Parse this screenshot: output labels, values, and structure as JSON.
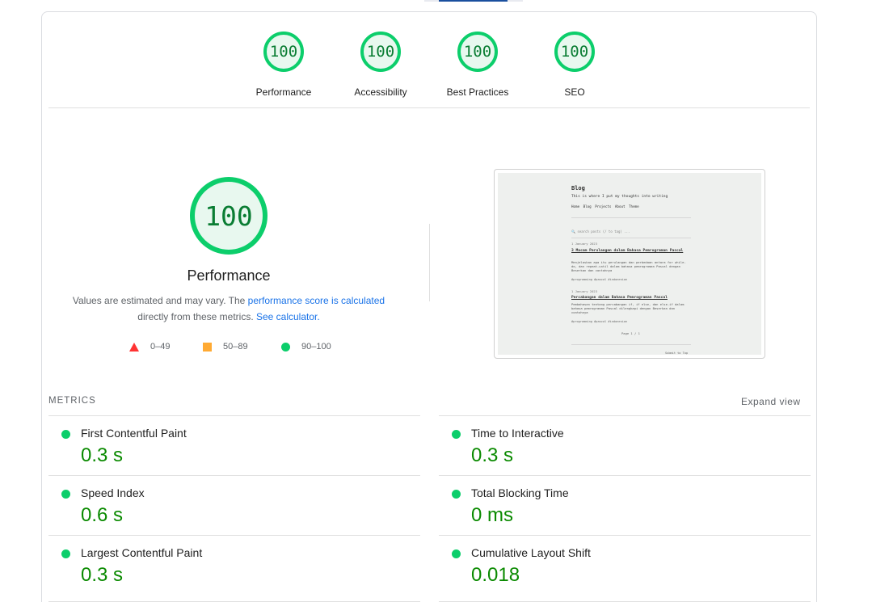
{
  "gauges": [
    {
      "score": "100",
      "label": "Performance"
    },
    {
      "score": "100",
      "label": "Accessibility"
    },
    {
      "score": "100",
      "label": "Best Practices"
    },
    {
      "score": "100",
      "label": "SEO"
    }
  ],
  "main": {
    "score": "100",
    "title": "Performance",
    "note_prefix": "Values are estimated and may vary. The ",
    "note_link1": "performance score is calculated",
    "note_mid": "directly from these metrics. ",
    "note_link2": "See calculator.",
    "legend": [
      {
        "shape": "triangle",
        "range": "0–49",
        "color": "#ff3333"
      },
      {
        "shape": "square",
        "range": "50–89",
        "color": "#ffaa33"
      },
      {
        "shape": "circle",
        "range": "90–100",
        "color": "#0cce6b"
      }
    ]
  },
  "preview": {
    "title": "Blog",
    "subtitle": "This is where I put my thoughts into writing",
    "nav": "Home Blog Projects About Theme",
    "search": "🔍 search posts (/ to tag) ...",
    "posts": [
      {
        "date": "1 January 2023",
        "title": "3 Macam Perulangan dalam Bahasa Pemrograman Pascal",
        "body": "Menjelaskan apa itu perulangan dan perbedaan antara for while-do, dan repeat-until dalam bahasa pemrograman Pascal dengan Beserkan dan contohnya",
        "tags": "#programming #pascal #indonesian"
      },
      {
        "date": "1 January 2023",
        "title": "Percabangan dalam Bahasa Pemrograman Pascal",
        "body": "Pembahasan tentang percabangan if, if else, dan else-if dalam bahasa pemrograman Pascal dilengkapi dengan Beserkan dan contohnya",
        "tags": "#programming #pascal #indonesian"
      }
    ],
    "pagination": "Page 1 / 1",
    "footer_link": "Submit to Top"
  },
  "metrics": {
    "header": "METRICS",
    "expand_label": "Expand view",
    "items": [
      {
        "name": "First Contentful Paint",
        "value": "0.3 s"
      },
      {
        "name": "Time to Interactive",
        "value": "0.3 s"
      },
      {
        "name": "Speed Index",
        "value": "0.6 s"
      },
      {
        "name": "Total Blocking Time",
        "value": "0 ms"
      },
      {
        "name": "Largest Contentful Paint",
        "value": "0.3 s"
      },
      {
        "name": "Cumulative Layout Shift",
        "value": "0.018"
      }
    ]
  },
  "colors": {
    "pass": "#0cce6b",
    "pass_text": "#0a8a00",
    "link": "#1a73e8"
  }
}
